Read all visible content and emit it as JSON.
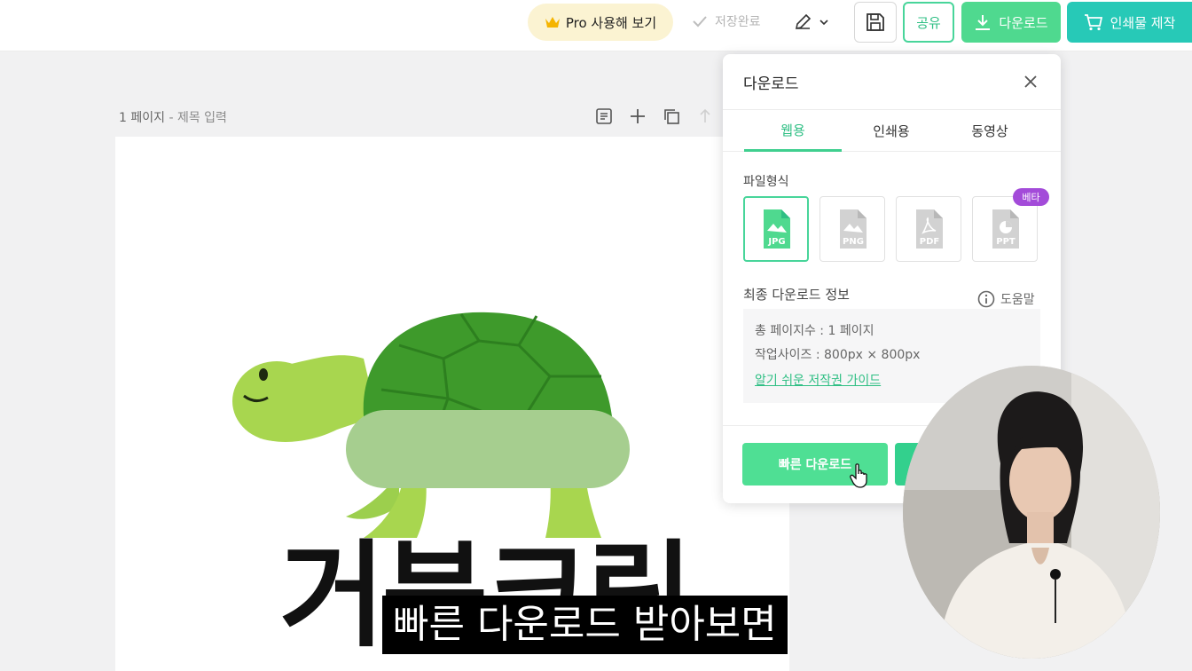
{
  "topbar": {
    "pro_label": "Pro 사용해 보기",
    "save_status": "저장완료",
    "share_label": "공유",
    "download_label": "다운로드",
    "print_label": "인쇄물 제작"
  },
  "page_header": {
    "page_number": "1 페이지",
    "separator": " - ",
    "title_placeholder": "제목 입력"
  },
  "canvas": {
    "title": "거북크림"
  },
  "subtitle": "빠른 다운로드 받아보면",
  "download_panel": {
    "title": "다운로드",
    "tabs": [
      {
        "label": "웹용",
        "active": true
      },
      {
        "label": "인쇄용",
        "active": false
      },
      {
        "label": "동영상",
        "active": false
      }
    ],
    "file_format_label": "파일형식",
    "formats": [
      {
        "label": "JPG",
        "selected": true
      },
      {
        "label": "PNG",
        "selected": false
      },
      {
        "label": "PDF",
        "selected": false
      },
      {
        "label": "PPT",
        "selected": false
      }
    ],
    "beta_badge": "베타",
    "info_label": "최종 다운로드 정보",
    "help_label": "도움말",
    "info_lines": [
      "총 페이지수 : 1 페이지",
      "작업사이즈 : 800px × 800px"
    ],
    "copyright_link": "알기 쉬운 저작권 가이드",
    "quick_download_label": "빠른 다운로드"
  },
  "colors": {
    "accent_green": "#4fd98f",
    "print_teal": "#27c9b7",
    "beta_purple": "#a34bd9",
    "pro_bg": "#fbf3d2"
  }
}
